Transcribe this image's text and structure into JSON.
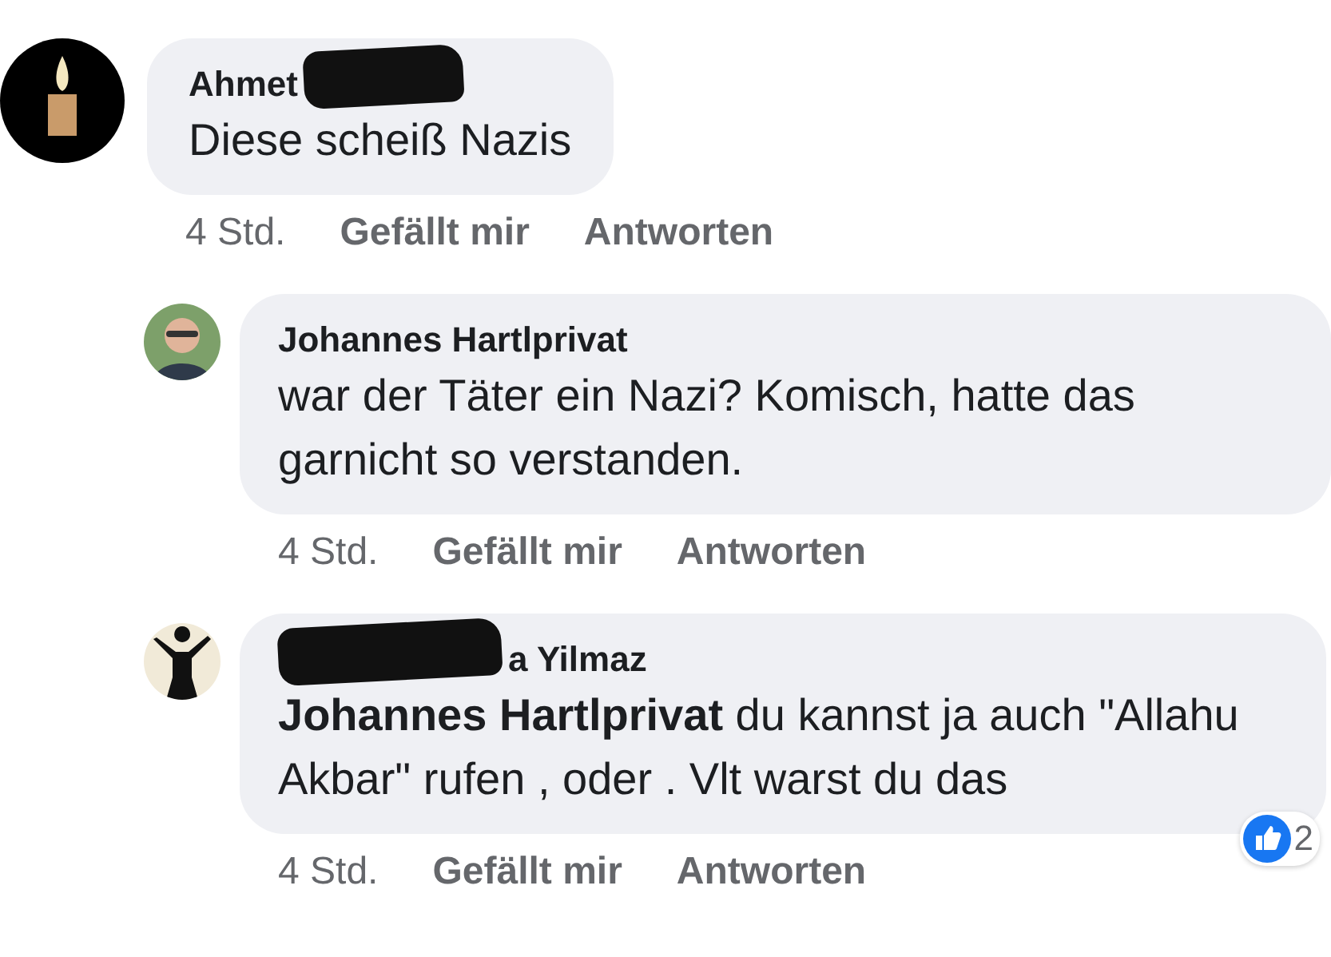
{
  "comments": [
    {
      "name_parts": [
        {
          "kind": "text",
          "text": "Ahmet"
        },
        {
          "kind": "redaction"
        }
      ],
      "avatar": {
        "kind": "candle"
      },
      "text": "Diese scheiß Nazis",
      "time": "4 Std.",
      "actions": [
        "Gefällt mir",
        "Antworten"
      ],
      "replies": [
        {
          "name_parts": [
            {
              "kind": "text",
              "text": "Johannes Hartlprivat"
            }
          ],
          "avatar": {
            "kind": "person"
          },
          "text": "war der Täter ein Nazi? Komisch, hatte das garnicht so verstanden.",
          "time": "4 Std.",
          "actions": [
            "Gefällt mir",
            "Antworten"
          ]
        },
        {
          "name_parts": [
            {
              "kind": "redaction"
            },
            {
              "kind": "text",
              "text": "a Yilmaz"
            }
          ],
          "avatar": {
            "kind": "silhouette"
          },
          "text": "**Johannes Hartlprivat** du kannst ja auch \"Allahu Akbar\" rufen , oder . Vlt warst du das",
          "time": "4 Std.",
          "actions": [
            "Gefällt mir",
            "Antworten"
          ],
          "reactions": {
            "count": "2"
          }
        }
      ]
    }
  ]
}
